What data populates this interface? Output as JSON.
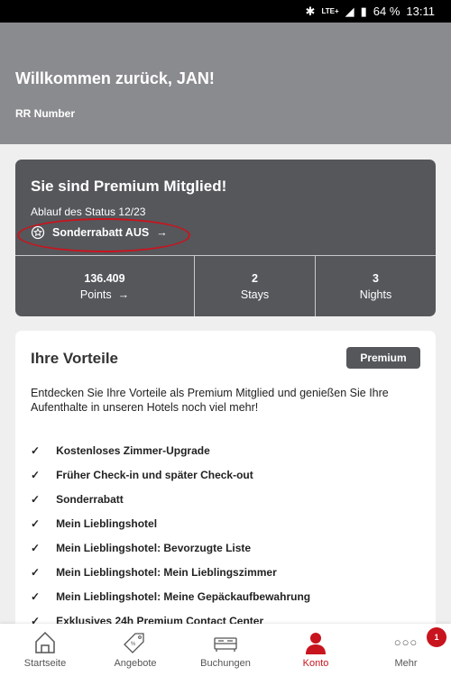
{
  "status_bar": {
    "network": "LTE+",
    "battery": "64 %",
    "time": "13:11"
  },
  "header": {
    "welcome": "Willkommen zurück, JAN!",
    "rr_number_label": "RR Number"
  },
  "status_card": {
    "title": "Sie sind Premium Mitglied!",
    "expiry": "Ablauf des Status 12/23",
    "discount_link": "Sonderrabatt AUS",
    "stats": [
      {
        "value": "136.409",
        "label": "Points"
      },
      {
        "value": "2",
        "label": "Stays"
      },
      {
        "value": "3",
        "label": "Nights"
      }
    ]
  },
  "benefits": {
    "title": "Ihre Vorteile",
    "badge": "Premium",
    "intro": "Entdecken Sie Ihre Vorteile als Premium Mitglied und genießen Sie Ihre Aufenthalte in unseren Hotels noch viel mehr!",
    "items": [
      "Kostenloses Zimmer-Upgrade",
      "Früher Check-in und später Check-out",
      "Sonderrabatt",
      "Mein Lieblingshotel",
      "Mein Lieblingshotel: Bevorzugte Liste",
      "Mein Lieblingshotel: Mein Lieblingszimmer",
      "Mein Lieblingshotel: Meine Gepäckaufbewahrung",
      "Exklusives 24h Premium Contact Center"
    ]
  },
  "nav": {
    "items": [
      {
        "label": "Startseite",
        "icon": "home-icon"
      },
      {
        "label": "Angebote",
        "icon": "tag-icon"
      },
      {
        "label": "Buchungen",
        "icon": "bed-icon"
      },
      {
        "label": "Konto",
        "icon": "user-icon"
      },
      {
        "label": "Mehr",
        "icon": "more-icon"
      }
    ],
    "active": "Konto",
    "badge": "1"
  },
  "colors": {
    "accent": "#c8141e",
    "card": "#55575b",
    "header": "#8a8b8f"
  }
}
